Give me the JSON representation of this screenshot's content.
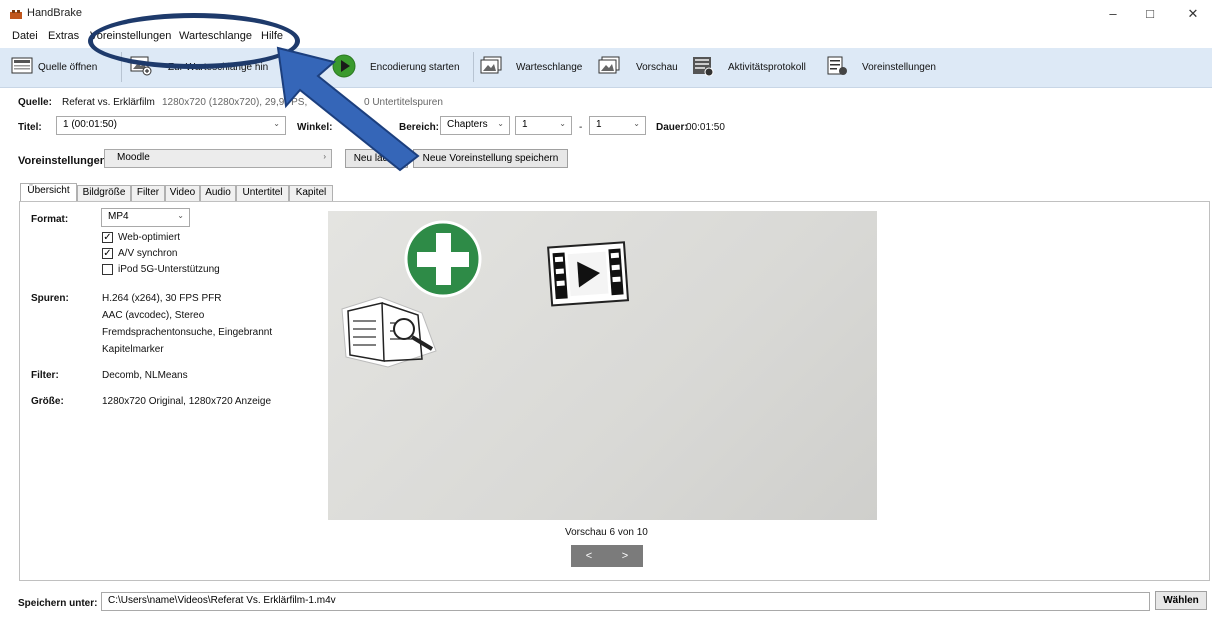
{
  "window": {
    "title": "HandBrake"
  },
  "menu": [
    "Datei",
    "Extras",
    "Voreinstellungen",
    "Warteschlange",
    "Hilfe"
  ],
  "toolbar": {
    "open_source": "Quelle öffnen",
    "add_queue": "Zur Warteschlange hin",
    "start_encode": "Encodierung starten",
    "queue": "Warteschlange",
    "preview": "Vorschau",
    "activity_log": "Aktivitätsprotokoll",
    "presets": "Voreinstellungen"
  },
  "source": {
    "label": "Quelle:",
    "name": "Referat vs. Erklärfilm",
    "info": "1280x720 (1280x720), 29,9",
    "info_fps": "FPS,",
    "subtitles": "0 Untertitelspuren"
  },
  "title_row": {
    "title_label": "Titel:",
    "title_value": "1 (00:01:50)",
    "angle_label": "Winkel:",
    "range_label": "Bereich:",
    "range_type": "Chapters",
    "range_start": "1",
    "range_dash": "-",
    "range_end": "1",
    "duration_label": "Dauer:",
    "duration_value": "00:01:50"
  },
  "preset_row": {
    "label": "Voreinstellungen",
    "value": "Moodle",
    "reload_button": "Neu laden",
    "save_new_button": "Neue Voreinstellung speichern"
  },
  "tabs": [
    "Übersicht",
    "Bildgröße",
    "Filter",
    "Video",
    "Audio",
    "Untertitel",
    "Kapitel"
  ],
  "summary": {
    "format_label": "Format:",
    "format_value": "MP4",
    "web_optimized": "Web-optimiert",
    "av_sync": "A/V synchron",
    "ipod": "iPod 5G-Unterstützung",
    "tracks_label": "Spuren:",
    "tracks": [
      "H.264 (x264), 30 FPS PFR",
      "AAC (avcodec), Stereo",
      "Fremdsprachentonsuche, Eingebrannt",
      "Kapitelmarker"
    ],
    "filter_label": "Filter:",
    "filter_value": "Decomb, NLMeans",
    "size_label": "Größe:",
    "size_value": "1280x720 Original, 1280x720 Anzeige"
  },
  "preview": {
    "caption": "Vorschau 6 von 10",
    "prev": "<",
    "next": ">"
  },
  "save": {
    "label": "Speichern unter:",
    "path": "C:\\Users\\name\\Videos\\Referat Vs. Erklärfilm-1.m4v",
    "browse_button": "Wählen"
  },
  "checkboxes": {
    "web_optimized": true,
    "av_sync": true,
    "ipod": false
  },
  "colors": {
    "toolbar_bg": "#dde9f6",
    "highlight": "#1e3a6b",
    "arrow": "#3566b8",
    "play_green": "#3a9a2e"
  }
}
